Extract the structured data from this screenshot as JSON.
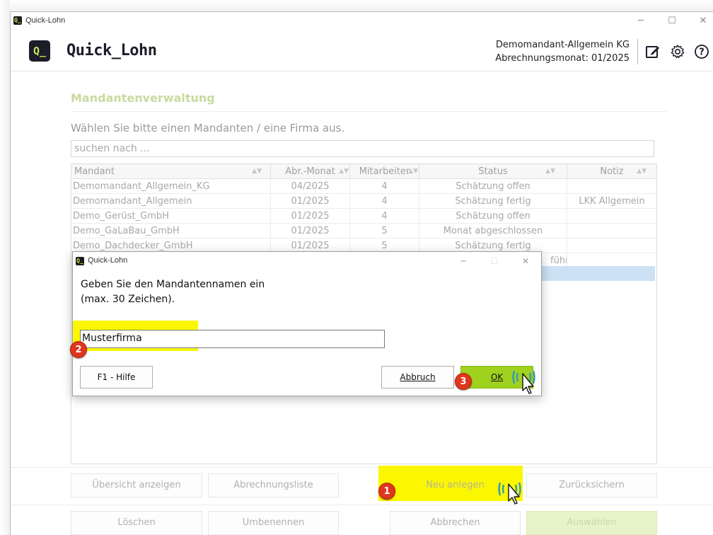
{
  "window": {
    "title": "Quick-Lohn",
    "minimize": "─",
    "maximize": "☐",
    "close": "✕"
  },
  "header": {
    "logo_mark": "Q_",
    "app_name": "Quick_Lohn",
    "client_name": "Demomandant-Allgemein KG",
    "billing_month": "Abrechnungsmonat: 01/2025"
  },
  "main": {
    "section_title": "Mandantenverwaltung",
    "instruction": "Wählen Sie bitte einen Mandanten / eine Firma aus.",
    "search_placeholder": "suchen nach ..."
  },
  "table": {
    "columns": [
      "Mandant",
      "Abr.-Monat",
      "Mitarbeiter",
      "Status",
      "Notiz"
    ],
    "rows": [
      [
        "Demomandant_Allgemein_KG",
        "04/2025",
        "4",
        "Schätzung offen",
        ""
      ],
      [
        "Demomandant_Allgemein",
        "01/2025",
        "4",
        "Schätzung fertig",
        "LKK Allgemein"
      ],
      [
        "Demo_Gerüst_GmbH",
        "01/2025",
        "4",
        "Schätzung offen",
        ""
      ],
      [
        "Demo_GaLaBau_GmbH",
        "01/2025",
        "5",
        "Monat abgeschlossen",
        ""
      ],
      [
        "Demo_Dachdecker_GmbH",
        "01/2025",
        "5",
        "Schätzung fertig",
        ""
      ],
      [
        "",
        "",
        "",
        "führt",
        ""
      ]
    ]
  },
  "footer": {
    "row1": [
      "Übersicht anzeigen",
      "Abrechnungsliste",
      "Neu anlegen",
      "Zurücksichern"
    ],
    "row2": [
      "Löschen",
      "Umbenennen",
      "Abbrechen",
      "Auswählen"
    ]
  },
  "dialog": {
    "title": "Quick-Lohn",
    "prompt_line1": "Geben Sie den Mandantennamen ein",
    "prompt_line2": "(max. 30 Zeichen).",
    "input_value": "Musterfirma",
    "help_button": "F1 - Hilfe",
    "cancel_button": "Abbruch",
    "ok_button": "OK"
  },
  "annotations": {
    "step1": "1",
    "step2": "2",
    "step3": "3"
  },
  "colors": {
    "highlight": "#faf700",
    "badge": "#e0351e",
    "ok_green": "#9fd21e",
    "brand_dark": "#1c1c2a",
    "brand_accent": "#c8e24a"
  }
}
